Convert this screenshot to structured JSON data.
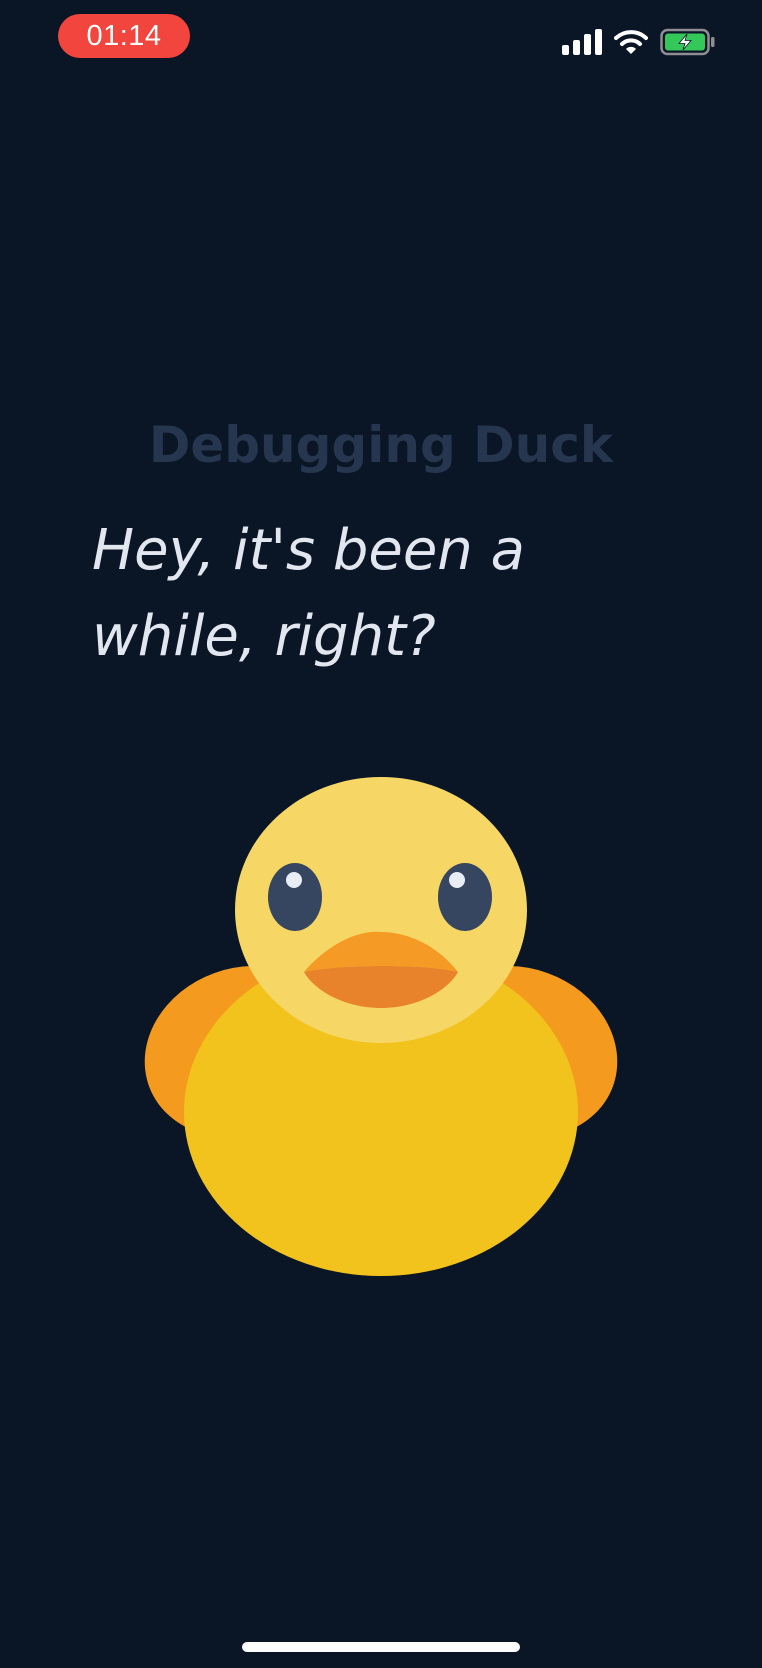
{
  "status_bar": {
    "time": "01:14",
    "signal_icon": "cellular-signal-icon",
    "wifi_icon": "wifi-icon",
    "battery_icon": "battery-charging-icon",
    "colors": {
      "time_pill": "#f2453d",
      "battery_fill": "#34c759"
    }
  },
  "app": {
    "title": "Debugging Duck",
    "message": "Hey, it's been a while, right?"
  },
  "duck": {
    "icon": "rubber-duck-icon",
    "colors": {
      "body": "#f2c31c",
      "head": "#f6d664",
      "wings": "#f49b1f",
      "beak_top": "#f59a25",
      "beak_bottom": "#e8832b",
      "eyes": "#374660",
      "eye_highlight": "#e9edf5"
    }
  },
  "colors": {
    "background": "#0a1526",
    "title": "#26364f",
    "message": "#e2e6ef"
  }
}
